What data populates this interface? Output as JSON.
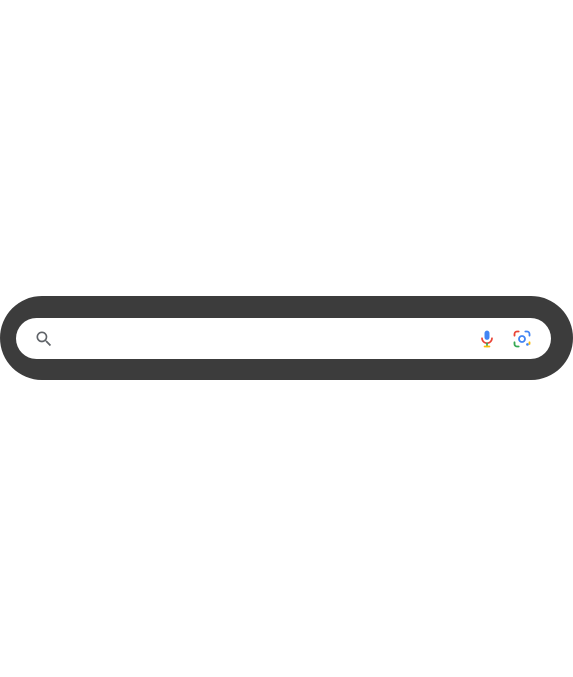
{
  "search_widget": {
    "search_icon": "search-icon",
    "input_value": "",
    "input_placeholder": "",
    "mic_icon": "microphone-icon",
    "lens_icon": "google-lens-icon"
  },
  "colors": {
    "frame": "#3c3c3c",
    "pill": "#ffffff",
    "icon_gray": "#5f6368",
    "google_blue": "#4285f4",
    "google_red": "#ea4335",
    "google_yellow": "#fbbc05",
    "google_green": "#34a853"
  }
}
